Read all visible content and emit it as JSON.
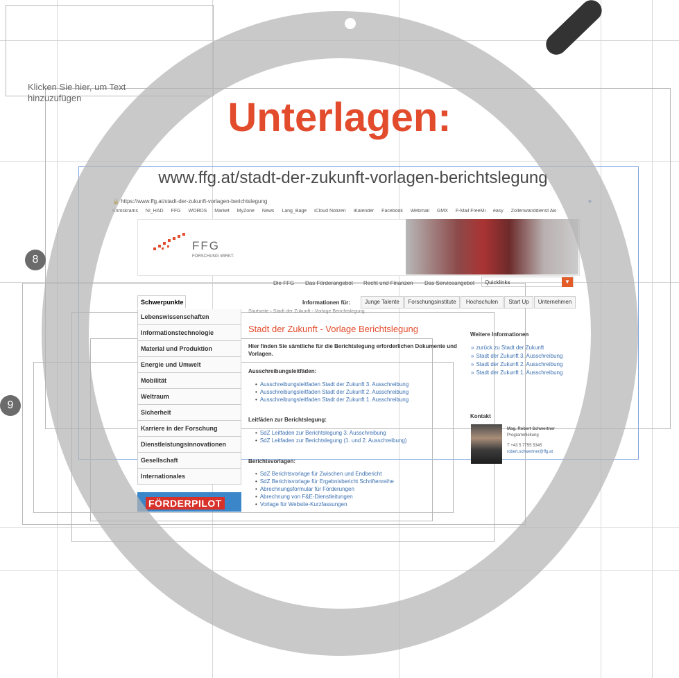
{
  "slide": {
    "placeholder": "Klicken Sie hier, um Text hinzuzufügen",
    "title": "Unterlagen:",
    "url": "www.ffg.at/stadt-der-zukunft-vorlagen-berichtslegung",
    "slide_numbers": [
      "8",
      "9"
    ]
  },
  "browser": {
    "address": "https://www.ffg.at/stadt-der-zukunft-vorlagen-berichtslegung",
    "bookmarks": [
      "Krimskrams",
      "NI_HAD",
      "FFG",
      "WORDS",
      "Market",
      "MyZone",
      "News",
      "Lang_Bage",
      "iCloud Notizen",
      "iKalender",
      "Facebook",
      "Webmail",
      "GMX",
      "F-Mail FreeMi",
      "easy",
      "Zollenwanddienst Aki"
    ]
  },
  "site": {
    "logo": "FFG",
    "logo_sub": "FORSCHUNG WIRKT.",
    "topnav": [
      "Die FFG",
      "Das Förderangebot",
      "Recht und Finanzen",
      "Das Serviceangebot"
    ],
    "quicklinks": "Quicklinks",
    "left_tab": "Schwerpunkte",
    "info_label": "Informationen für:",
    "tabs": [
      "Junge Talente",
      "Forschungsinstitute",
      "Hochschulen",
      "Start Up",
      "Unternehmen"
    ],
    "menu": [
      "Lebenswissenschaften",
      "Informationstechnologie",
      "Material und Produktion",
      "Energie und Umwelt",
      "Mobilität",
      "Weltraum",
      "Sicherheit",
      "Karriere in der Forschung",
      "Dienstleistungsinnovationen",
      "Gesellschaft",
      "Internationales"
    ],
    "foerderpilot": "FÖRDERPILOT",
    "breadcrumb": "Startseite › Stadt der Zukunft - Vorlage Berichtslegung",
    "page_title": "Stadt der Zukunft - Vorlage Berichtslegung",
    "intro": "Hier finden Sie sämtliche für die Berichtslegung erforderlichen Dokumente und Vorlagen.",
    "sections": [
      {
        "title": "Ausschreibungsleitfäden:",
        "items": [
          "Ausschreibungsleitfaden Stadt der Zukunft 3. Ausschreibung",
          "Ausschreibungsleitfaden Stadt der Zukunft 2. Ausschreibung",
          "Ausschreibungsleitfaden Stadt der Zukunft 1. Ausschreibung"
        ]
      },
      {
        "title": "Leitfäden zur Berichtslegung:",
        "items": [
          "SdZ Leitfaden zur Berichtslegung 3. Ausschreibung",
          "SdZ Leitfaden zur Berichtslegung (1. und 2. Ausschreibung)"
        ]
      },
      {
        "title": "Berichtsvorlagen:",
        "items": [
          "SdZ Berichtsvorlage für Zwischen und Endbericht",
          "SdZ Berichtsvorlage für Ergebnisbericht Schriftenreihe",
          "Abrechnungsformular für Förderungen",
          "Abrechnung von F&E-Dienstleitungen",
          "Vorlage für Website-Kurzfassungen"
        ]
      }
    ],
    "right_title": "Weitere Informationen",
    "right_links": [
      "zurück zu Stadt der Zukunft",
      "Stadt der Zukunft 3. Ausschreibung",
      "Stadt der Zukunft 2. Ausschreibung",
      "Stadt der Zukunft 1. Ausschreibung"
    ],
    "contact_title": "Kontakt",
    "contact_name": "Mag. Robert Schwertner",
    "contact_role": "Programmleitung",
    "contact_phone": "T +43 5 7755 5345",
    "contact_email": "robert.schwertner@ffg.at"
  },
  "colors": {
    "accent": "#e24b2c",
    "link": "#3a6fb0",
    "ring": "#b4b4b4"
  }
}
